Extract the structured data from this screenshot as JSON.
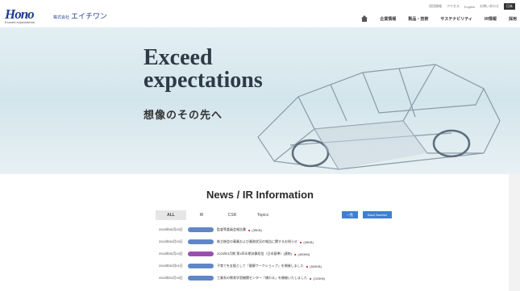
{
  "header": {
    "logo_text": "Hono",
    "logo_tagline": "Exceed expectations",
    "company_prefix": "株式会社",
    "company_name": "エイチワン",
    "util_links": [
      "採用情報",
      "アクセス",
      "English",
      "お問い合わせ"
    ],
    "lang": "日本",
    "nav_items": [
      "企業情報",
      "製品・技術",
      "サステナビリティ",
      "IR情報",
      "採用"
    ]
  },
  "hero": {
    "title_line1": "Exceed",
    "title_line2": "expectations",
    "subtitle": "想像のその先へ"
  },
  "news": {
    "title": "News / IR Information",
    "tabs": [
      "ALL",
      "IR",
      "CSR",
      "Topics"
    ],
    "buttons": [
      "一覧",
      "Back Number"
    ],
    "items": [
      {
        "date": "2024年05月20日",
        "text": "監査等委員会報告書",
        "size": "(39KB)",
        "purple": false
      },
      {
        "date": "2024年05月20日",
        "text": "株主総会の事業および業務状況の報告に関するお知らせ",
        "size": "(39KB)",
        "purple": false
      },
      {
        "date": "2024年05月13日",
        "text": "2025年3月期 第1四半期決算短信〔日本基準〕(連結)",
        "size": "(450KB)",
        "purple": true
      },
      {
        "date": "2024年05月01日",
        "text": "子育てを支援として「健康ワークショップ」を開催しました",
        "size": "(500KB)",
        "purple": false
      },
      {
        "date": "2024年03月15日",
        "text": "工業系の教育学習機関センター「橋わる」を開催いたしました",
        "size": "(120KB)",
        "purple": false
      }
    ]
  }
}
